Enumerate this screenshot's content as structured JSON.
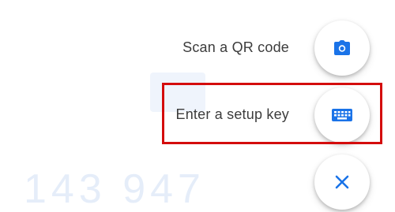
{
  "background": {
    "code_digits": "143 947"
  },
  "speed_dial": {
    "options": [
      {
        "label": "Scan a QR code",
        "icon": "camera-icon"
      },
      {
        "label": "Enter a setup key",
        "icon": "keyboard-icon"
      }
    ],
    "close_icon": "close-icon"
  },
  "colors": {
    "accent": "#1a73e8",
    "highlight": "#d40c0c",
    "label_text": "#3c3c3c"
  }
}
